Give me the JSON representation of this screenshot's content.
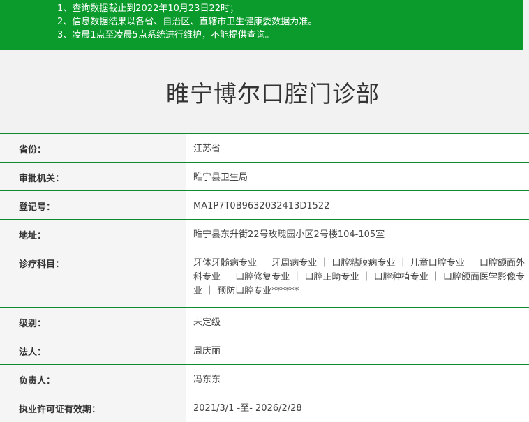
{
  "notice": {
    "lines": [
      "1、查询数据截止到2022年10月23日22时；",
      "2、信息数据结果以各省、自治区、直辖市卫生健康委数据为准。",
      "3、凌晨1点至凌晨5点系统进行维护，不能提供查询。"
    ]
  },
  "clinic": {
    "title": "睢宁博尔口腔门诊部"
  },
  "info": {
    "province": {
      "label": "省份：",
      "value": "江苏省"
    },
    "authority": {
      "label": "审批机关：",
      "value": "睢宁县卫生局"
    },
    "registration": {
      "label": "登记号：",
      "value": "MA1P7T0B9632032413D1522"
    },
    "address": {
      "label": "地址：",
      "value": "睢宁县东升街22号玫瑰园小区2号楼104-105室"
    },
    "departments": {
      "label": "诊疗科目：",
      "value": "牙体牙髓病专业 ｜ 牙周病专业 ｜ 口腔粘膜病专业 ｜ 儿童口腔专业 ｜ 口腔颌面外科专业 ｜ 口腔修复专业 ｜ 口腔正畸专业 ｜ 口腔种植专业 ｜ 口腔颌面医学影像专业 ｜ 预防口腔专业******"
    },
    "level": {
      "label": "级别：",
      "value": "未定级"
    },
    "legal_person": {
      "label": "法人：",
      "value": "周庆丽"
    },
    "person_in_charge": {
      "label": "负责人：",
      "value": "冯东东"
    },
    "license_validity": {
      "label": "执业许可证有效期：",
      "value": "2021/3/1 -至- 2026/2/28"
    }
  },
  "colors": {
    "notice_bg": "#0a9b2c",
    "row_border": "#0f8a2c"
  }
}
